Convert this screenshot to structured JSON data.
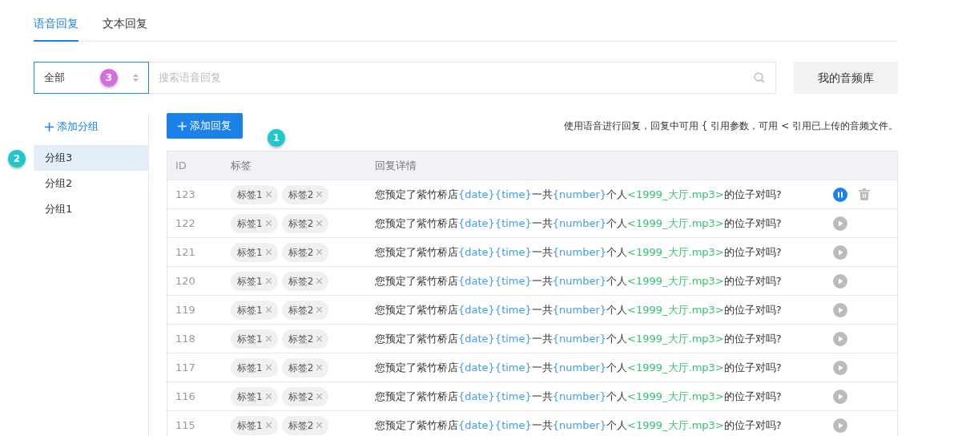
{
  "tabs": [
    {
      "label": "语音回复",
      "selected": true
    },
    {
      "label": "文本回复",
      "selected": false
    }
  ],
  "filter": {
    "value": "全部",
    "marker": {
      "label": "3",
      "color": "#d36fe0"
    }
  },
  "search": {
    "placeholder": "搜索语音回复"
  },
  "library_button": "我的音频库",
  "sidebar": {
    "add_label": "添加分组",
    "marker": {
      "label": "2",
      "color": "#1fc8cc"
    },
    "items": [
      {
        "label": "分组3",
        "selected": true
      },
      {
        "label": "分组2",
        "selected": false
      },
      {
        "label": "分组1",
        "selected": false
      }
    ]
  },
  "add_reply_button": "添加回复",
  "add_marker": {
    "label": "1",
    "color": "#1fc8cc"
  },
  "hint": "使用语音进行回复，回复中可用 { 引用参数，可用 < 引用已上传的音频文件。",
  "table": {
    "columns": [
      "ID",
      "标签",
      "回复详情"
    ],
    "rows": [
      {
        "id": "123",
        "tags": [
          "标签1",
          "标签2"
        ],
        "detail": [
          {
            "kind": "text",
            "text": "您预定了紫竹桥店"
          },
          {
            "kind": "param",
            "text": "{date}"
          },
          {
            "kind": "param",
            "text": "{time}"
          },
          {
            "kind": "text",
            "text": "一共"
          },
          {
            "kind": "param",
            "text": "{number}"
          },
          {
            "kind": "text",
            "text": "个人"
          },
          {
            "kind": "audio",
            "text": "<1999_大厅.mp3>"
          },
          {
            "kind": "text",
            "text": "的位子对吗?"
          }
        ],
        "playing": true
      },
      {
        "id": "122",
        "tags": [
          "标签1",
          "标签2"
        ],
        "detail": [
          {
            "kind": "text",
            "text": "您预定了紫竹桥店"
          },
          {
            "kind": "param",
            "text": "{date}"
          },
          {
            "kind": "param",
            "text": "{time}"
          },
          {
            "kind": "text",
            "text": "一共"
          },
          {
            "kind": "param",
            "text": "{number}"
          },
          {
            "kind": "text",
            "text": "个人"
          },
          {
            "kind": "audio",
            "text": "<1999_大厅.mp3>"
          },
          {
            "kind": "text",
            "text": "的位子对吗?"
          }
        ],
        "playing": false
      },
      {
        "id": "121",
        "tags": [
          "标签1",
          "标签2"
        ],
        "detail": [
          {
            "kind": "text",
            "text": "您预定了紫竹桥店"
          },
          {
            "kind": "param",
            "text": "{date}"
          },
          {
            "kind": "param",
            "text": "{time}"
          },
          {
            "kind": "text",
            "text": "一共"
          },
          {
            "kind": "param",
            "text": "{number}"
          },
          {
            "kind": "text",
            "text": "个人"
          },
          {
            "kind": "audio",
            "text": "<1999_大厅.mp3>"
          },
          {
            "kind": "text",
            "text": "的位子对吗?"
          }
        ],
        "playing": false
      },
      {
        "id": "120",
        "tags": [
          "标签1",
          "标签2"
        ],
        "detail": [
          {
            "kind": "text",
            "text": "您预定了紫竹桥店"
          },
          {
            "kind": "param",
            "text": "{date}"
          },
          {
            "kind": "param",
            "text": "{time}"
          },
          {
            "kind": "text",
            "text": "一共"
          },
          {
            "kind": "param",
            "text": "{number}"
          },
          {
            "kind": "text",
            "text": "个人"
          },
          {
            "kind": "audio",
            "text": "<1999_大厅.mp3>"
          },
          {
            "kind": "text",
            "text": "的位子对吗?"
          }
        ],
        "playing": false
      },
      {
        "id": "119",
        "tags": [
          "标签1",
          "标签2"
        ],
        "detail": [
          {
            "kind": "text",
            "text": "您预定了紫竹桥店"
          },
          {
            "kind": "param",
            "text": "{date}"
          },
          {
            "kind": "param",
            "text": "{time}"
          },
          {
            "kind": "text",
            "text": "一共"
          },
          {
            "kind": "param",
            "text": "{number}"
          },
          {
            "kind": "text",
            "text": "个人"
          },
          {
            "kind": "audio",
            "text": "<1999_大厅.mp3>"
          },
          {
            "kind": "text",
            "text": "的位子对吗?"
          }
        ],
        "playing": false
      },
      {
        "id": "118",
        "tags": [
          "标签1",
          "标签2"
        ],
        "detail": [
          {
            "kind": "text",
            "text": "您预定了紫竹桥店"
          },
          {
            "kind": "param",
            "text": "{date}"
          },
          {
            "kind": "param",
            "text": "{time}"
          },
          {
            "kind": "text",
            "text": "一共"
          },
          {
            "kind": "param",
            "text": "{number}"
          },
          {
            "kind": "text",
            "text": "个人"
          },
          {
            "kind": "audio",
            "text": "<1999_大厅.mp3>"
          },
          {
            "kind": "text",
            "text": "的位子对吗?"
          }
        ],
        "playing": false
      },
      {
        "id": "117",
        "tags": [
          "标签1",
          "标签2"
        ],
        "detail": [
          {
            "kind": "text",
            "text": "您预定了紫竹桥店"
          },
          {
            "kind": "param",
            "text": "{date}"
          },
          {
            "kind": "param",
            "text": "{time}"
          },
          {
            "kind": "text",
            "text": "一共"
          },
          {
            "kind": "param",
            "text": "{number}"
          },
          {
            "kind": "text",
            "text": "个人"
          },
          {
            "kind": "audio",
            "text": "<1999_大厅.mp3>"
          },
          {
            "kind": "text",
            "text": "的位子对吗?"
          }
        ],
        "playing": false
      },
      {
        "id": "116",
        "tags": [
          "标签1",
          "标签2"
        ],
        "detail": [
          {
            "kind": "text",
            "text": "您预定了紫竹桥店"
          },
          {
            "kind": "param",
            "text": "{date}"
          },
          {
            "kind": "param",
            "text": "{time}"
          },
          {
            "kind": "text",
            "text": "一共"
          },
          {
            "kind": "param",
            "text": "{number}"
          },
          {
            "kind": "text",
            "text": "个人"
          },
          {
            "kind": "audio",
            "text": "<1999_大厅.mp3>"
          },
          {
            "kind": "text",
            "text": "的位子对吗?"
          }
        ],
        "playing": false
      },
      {
        "id": "115",
        "tags": [
          "标签1",
          "标签2"
        ],
        "detail": [
          {
            "kind": "text",
            "text": "您预定了紫竹桥店"
          },
          {
            "kind": "param",
            "text": "{date}"
          },
          {
            "kind": "param",
            "text": "{time}"
          },
          {
            "kind": "text",
            "text": "一共"
          },
          {
            "kind": "param",
            "text": "{number}"
          },
          {
            "kind": "text",
            "text": "个人"
          },
          {
            "kind": "audio",
            "text": "<1999_大厅.mp3>"
          },
          {
            "kind": "text",
            "text": "的位子对吗?"
          }
        ],
        "playing": false
      }
    ]
  }
}
